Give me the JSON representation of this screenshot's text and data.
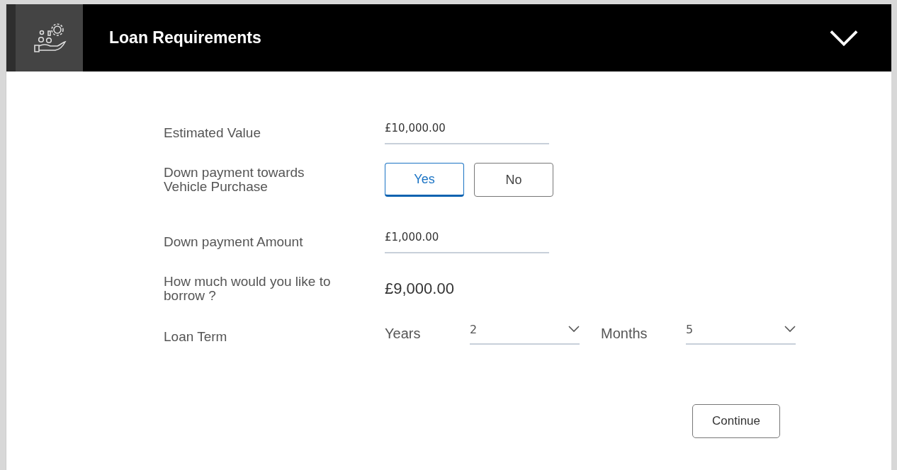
{
  "header": {
    "title": "Loan Requirements",
    "expanded": true
  },
  "fields": [
    {
      "kind": "input",
      "label": "Estimated Value",
      "value": "£10,000.00"
    },
    {
      "kind": "toggle",
      "label": "Down payment towards Vehicle Purchase",
      "options": [
        {
          "label": "Yes",
          "selected": true
        },
        {
          "label": "No",
          "selected": false
        }
      ]
    },
    {
      "kind": "input",
      "label": "Down payment Amount",
      "value": "£1,000.00"
    },
    {
      "kind": "text",
      "label": "How much would you like to borrow ?",
      "value": "£9,000.00"
    },
    {
      "kind": "term",
      "label": "Loan Term",
      "selects": [
        {
          "label": "Years",
          "value": "2"
        },
        {
          "label": "Months",
          "value": "5"
        }
      ]
    }
  ],
  "button": "Continue"
}
